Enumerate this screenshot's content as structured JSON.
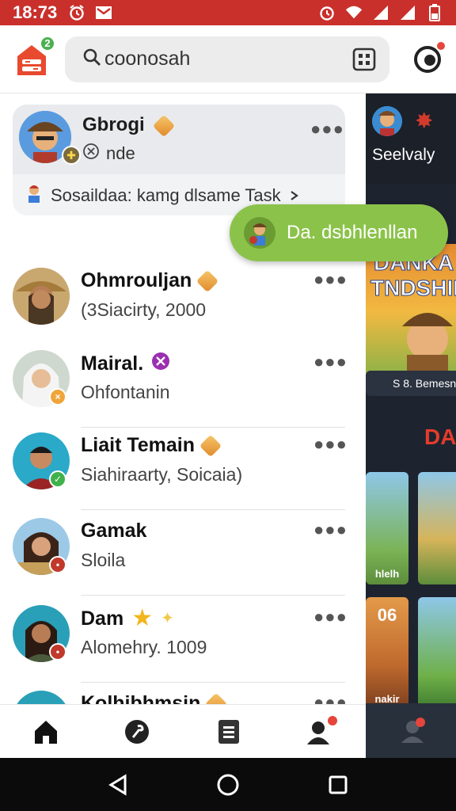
{
  "status_bar": {
    "time": "18:73",
    "left_icons": [
      "alarm-icon",
      "mail-icon"
    ],
    "right_icons": [
      "alarm-icon",
      "wifi-icon",
      "signal-icon",
      "signal-icon",
      "battery-icon"
    ]
  },
  "app_bar": {
    "logo_badge": "2",
    "search_text": "coonosah",
    "icons": [
      "app-logo-icon",
      "search-icon",
      "qr-icon",
      "profile-icon"
    ]
  },
  "pinned": {
    "name": "Gbrogi",
    "status": "nde",
    "task": "Sosaildaa: kamg dlsame Task"
  },
  "fab": {
    "label": "Da. dsbhlenllan"
  },
  "chats": [
    {
      "name": "Ohmrouljan",
      "sub": "(3Siacirty, 2000",
      "badge_color": "",
      "accent": "gem"
    },
    {
      "name": "Mairal.",
      "sub": "Ohfontanin",
      "badge_color": "#f0a53a",
      "accent": "purple"
    },
    {
      "name": "Liait Temain",
      "sub": "Siahiraarty, Soicaia)",
      "badge_color": "#3fb24a",
      "accent": "gem"
    },
    {
      "name": "Gamak",
      "sub": "Sloila",
      "badge_color": "#c0392b",
      "accent": ""
    },
    {
      "name": "Dam",
      "sub": "Alomehry. 1009",
      "badge_color": "#c0392b",
      "accent": "star"
    },
    {
      "name": "Kolhibhmsin",
      "sub": "",
      "badge_color": "",
      "accent": "gem"
    }
  ],
  "right_panel": {
    "name": "Seelvaly",
    "banner_title_1": "DANKA",
    "banner_title_2": "TNDSHIP",
    "caption": "S 8. Bemesn",
    "heading": "DA",
    "card_labels": [
      "hlelh",
      "06",
      "nakir"
    ]
  },
  "bottom_nav": [
    "home-icon",
    "tool-icon",
    "list-icon",
    "profile-icon"
  ],
  "system_nav": [
    "back-icon",
    "home-circle-icon",
    "recents-icon"
  ],
  "colors": {
    "status_bar": "#c9302c",
    "fab": "#8bc34a",
    "accent_red": "#e5453b"
  }
}
